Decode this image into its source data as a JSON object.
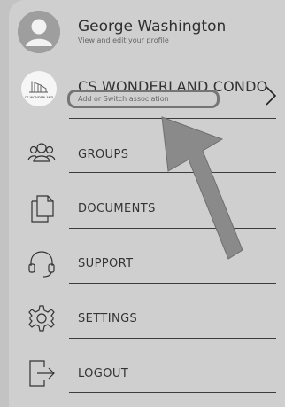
{
  "profile": {
    "name": "George Washington",
    "subtitle": "View and edit your profile",
    "avatar_icon": "user-avatar-icon"
  },
  "association": {
    "name": "CS WONDERLAND CONDO",
    "subtitle": "Add or Switch association",
    "logo_text": "CS WONDERLAND",
    "chevron_icon": "chevron-right-icon"
  },
  "menu": [
    {
      "label": "GROUPS",
      "icon": "groups-icon"
    },
    {
      "label": "DOCUMENTS",
      "icon": "documents-icon"
    },
    {
      "label": "SUPPORT",
      "icon": "headset-icon"
    },
    {
      "label": "SETTINGS",
      "icon": "gear-icon"
    },
    {
      "label": "LOGOUT",
      "icon": "logout-icon"
    }
  ],
  "colors": {
    "background": "#c3c3c3",
    "panel": "#cfcfcf",
    "text": "#333333",
    "annotation": "#757575"
  }
}
